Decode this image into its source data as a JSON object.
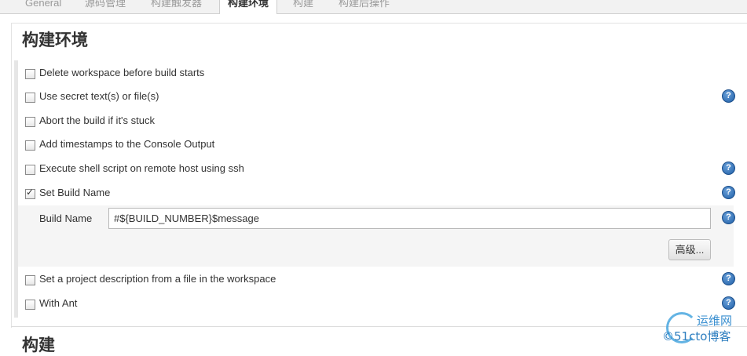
{
  "tabs": [
    {
      "label": "General"
    },
    {
      "label": "源码管理"
    },
    {
      "label": "构建触发器"
    },
    {
      "label": "构建环境"
    },
    {
      "label": "构建"
    },
    {
      "label": "构建后操作"
    }
  ],
  "section": {
    "title": "构建环境"
  },
  "options": [
    {
      "label": "Delete workspace before build starts",
      "checked": false,
      "help": false
    },
    {
      "label": "Use secret text(s) or file(s)",
      "checked": false,
      "help": true
    },
    {
      "label": "Abort the build if it's stuck",
      "checked": false,
      "help": false
    },
    {
      "label": "Add timestamps to the Console Output",
      "checked": false,
      "help": false
    },
    {
      "label": "Execute shell script on remote host using ssh",
      "checked": false,
      "help": true
    },
    {
      "label": "Set Build Name",
      "checked": true,
      "help": true
    },
    {
      "label": "Set a project description from a file in the workspace",
      "checked": false,
      "help": true
    },
    {
      "label": "With Ant",
      "checked": false,
      "help": true
    }
  ],
  "build_name": {
    "label": "Build Name",
    "value": "#${BUILD_NUMBER}$message",
    "advanced_button": "高级..."
  },
  "next_section": {
    "title": "构建"
  },
  "help_icon": {
    "glyph": "?",
    "color": "#1f5fa8"
  },
  "watermark": {
    "top": "运维网",
    "bottom": "©51cto博客"
  }
}
